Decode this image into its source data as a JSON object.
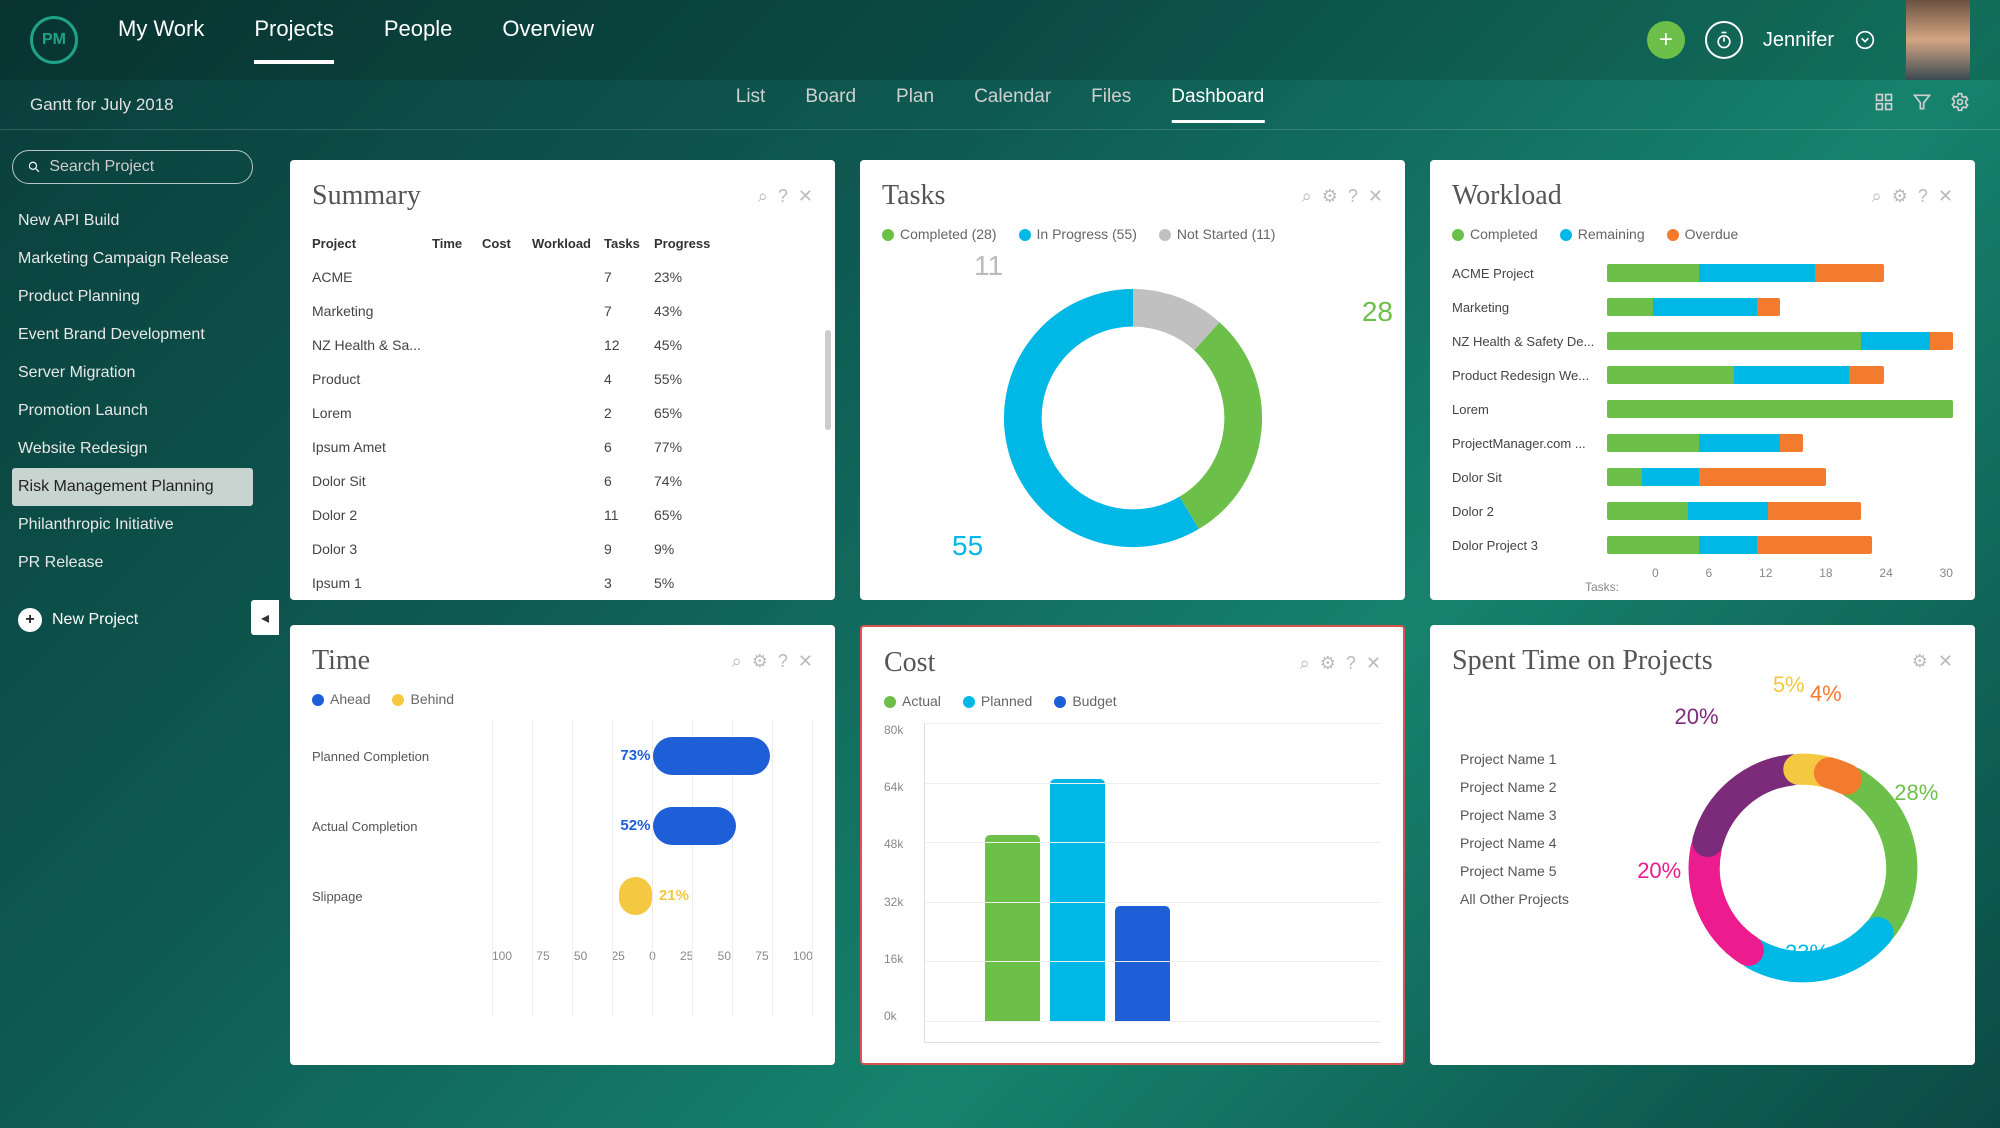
{
  "brand": "PM",
  "nav": {
    "items": [
      "My Work",
      "Projects",
      "People",
      "Overview"
    ],
    "active": 1
  },
  "topright": {
    "user": "Jennifer"
  },
  "crumb": "Gantt for July 2018",
  "subtabs": {
    "items": [
      "List",
      "Board",
      "Plan",
      "Calendar",
      "Files",
      "Dashboard"
    ],
    "active": 5
  },
  "search": {
    "placeholder": "Search Project"
  },
  "projects": [
    "New API Build",
    "Marketing Campaign Release",
    "Product Planning",
    "Event Brand Development",
    "Server Migration",
    "Promotion Launch",
    "Website Redesign",
    "Risk Management Planning",
    "Philanthropic Initiative",
    "PR Release"
  ],
  "projects_selected": 7,
  "new_project": "New Project",
  "summary": {
    "title": "Summary",
    "headers": [
      "Project",
      "Time",
      "Cost",
      "Workload",
      "Tasks",
      "Progress"
    ],
    "rows": [
      {
        "name": "ACME",
        "time": "r",
        "cost": "y",
        "work": "r",
        "tasks": 7,
        "progress": "23%"
      },
      {
        "name": "Marketing",
        "time": "g",
        "cost": "y",
        "work": "r",
        "tasks": 7,
        "progress": "43%"
      },
      {
        "name": "NZ Health & Sa...",
        "time": "g",
        "cost": "g",
        "work": "",
        "tasks": 12,
        "progress": "45%"
      },
      {
        "name": "Product",
        "time": "g",
        "cost": "",
        "work": "",
        "tasks": 4,
        "progress": "55%"
      },
      {
        "name": "Lorem",
        "time": "",
        "cost": "",
        "work": "",
        "tasks": 2,
        "progress": "65%"
      },
      {
        "name": "Ipsum Amet",
        "time": "",
        "cost": "",
        "work": "",
        "tasks": 6,
        "progress": "77%"
      },
      {
        "name": "Dolor Sit",
        "time": "",
        "cost": "",
        "work": "",
        "tasks": 6,
        "progress": "74%"
      },
      {
        "name": "Dolor 2",
        "time": "",
        "cost": "",
        "work": "",
        "tasks": 11,
        "progress": "65%"
      },
      {
        "name": "Dolor 3",
        "time": "",
        "cost": "",
        "work": "r",
        "tasks": 9,
        "progress": "9%"
      },
      {
        "name": "Ipsum 1",
        "time": "",
        "cost": "",
        "work": "r",
        "tasks": 3,
        "progress": "5%"
      }
    ]
  },
  "tasks": {
    "title": "Tasks",
    "legend": [
      {
        "label": "Completed",
        "count": 28,
        "color": "#6cc04a"
      },
      {
        "label": "In Progress",
        "count": 55,
        "color": "#00b8e6"
      },
      {
        "label": "Not Started",
        "count": 11,
        "color": "#c0c0c0"
      }
    ]
  },
  "workload": {
    "title": "Workload",
    "legend": [
      {
        "label": "Completed",
        "color": "#6cc04a"
      },
      {
        "label": "Remaining",
        "color": "#00b8e6"
      },
      {
        "label": "Overdue",
        "color": "#f37b2e"
      }
    ],
    "rows": [
      {
        "name": "ACME Project",
        "c": 8,
        "r": 10,
        "o": 6
      },
      {
        "name": "Marketing",
        "c": 4,
        "r": 9,
        "o": 2
      },
      {
        "name": "NZ Health & Safety De...",
        "c": 22,
        "r": 6,
        "o": 2
      },
      {
        "name": "Product Redesign We...",
        "c": 11,
        "r": 10,
        "o": 3
      },
      {
        "name": "Lorem",
        "c": 30,
        "r": 0,
        "o": 0
      },
      {
        "name": "ProjectManager.com ...",
        "c": 8,
        "r": 7,
        "o": 2
      },
      {
        "name": "Dolor Sit",
        "c": 3,
        "r": 5,
        "o": 11
      },
      {
        "name": "Dolor 2",
        "c": 7,
        "r": 7,
        "o": 8
      },
      {
        "name": "Dolor Project 3",
        "c": 8,
        "r": 5,
        "o": 10
      }
    ],
    "axis": [
      "0",
      "6",
      "12",
      "18",
      "24",
      "30"
    ],
    "axis_label": "Tasks:",
    "max": 30
  },
  "time": {
    "title": "Time",
    "legend": [
      {
        "label": "Ahead",
        "color": "#1e5fd8"
      },
      {
        "label": "Behind",
        "color": "#f5c842"
      }
    ],
    "rows": [
      {
        "label": "Planned Completion",
        "value": 73,
        "color": "#1e5fd8",
        "dir": 1
      },
      {
        "label": "Actual Completion",
        "value": 52,
        "color": "#1e5fd8",
        "dir": 1
      },
      {
        "label": "Slippage",
        "value": 21,
        "color": "#f5c842",
        "dir": -1
      }
    ],
    "axis": [
      "100",
      "75",
      "50",
      "25",
      "0",
      "25",
      "50",
      "75",
      "100"
    ]
  },
  "cost": {
    "title": "Cost",
    "legend": [
      {
        "label": "Actual",
        "color": "#6cc04a"
      },
      {
        "label": "Planned",
        "color": "#00b8e6"
      },
      {
        "label": "Budget",
        "color": "#1e5fd8"
      }
    ],
    "y": [
      "80k",
      "64k",
      "48k",
      "32k",
      "16k",
      "0k"
    ],
    "bars": [
      {
        "v": 50,
        "color": "#6cc04a"
      },
      {
        "v": 65,
        "color": "#00b8e6"
      },
      {
        "v": 31,
        "color": "#1e5fd8"
      }
    ],
    "max": 80
  },
  "spent": {
    "title": "Spent Time on Projects",
    "legend": [
      {
        "label": "Project Name 1",
        "color": "#6cc04a"
      },
      {
        "label": "Project Name 2",
        "color": "#00b8e6"
      },
      {
        "label": "Project Name 3",
        "color": "#ec1b8e"
      },
      {
        "label": "Project Name 4",
        "color": "#7c2b7a"
      },
      {
        "label": "Project Name 5",
        "color": "#f5c842"
      },
      {
        "label": "All Other Projects",
        "color": "#f37b2e"
      }
    ],
    "slices": [
      {
        "pct": 28,
        "color": "#6cc04a"
      },
      {
        "pct": 23,
        "color": "#00b8e6"
      },
      {
        "pct": 20,
        "color": "#ec1b8e"
      },
      {
        "pct": 20,
        "color": "#7c2b7a"
      },
      {
        "pct": 5,
        "color": "#f5c842"
      },
      {
        "pct": 4,
        "color": "#f37b2e"
      }
    ]
  },
  "chart_data": [
    {
      "type": "pie",
      "title": "Tasks",
      "series": [
        {
          "name": "Completed",
          "value": 28
        },
        {
          "name": "In Progress",
          "value": 55
        },
        {
          "name": "Not Started",
          "value": 11
        }
      ]
    },
    {
      "type": "bar",
      "title": "Workload",
      "xlabel": "Tasks",
      "axis": [
        0,
        6,
        12,
        18,
        24,
        30
      ],
      "categories": [
        "ACME Project",
        "Marketing",
        "NZ Health & Safety De...",
        "Product Redesign We...",
        "Lorem",
        "ProjectManager.com ...",
        "Dolor Sit",
        "Dolor 2",
        "Dolor Project 3"
      ],
      "series": [
        {
          "name": "Completed",
          "values": [
            8,
            4,
            22,
            11,
            30,
            8,
            3,
            7,
            8
          ]
        },
        {
          "name": "Remaining",
          "values": [
            10,
            9,
            6,
            10,
            0,
            7,
            5,
            7,
            5
          ]
        },
        {
          "name": "Overdue",
          "values": [
            6,
            2,
            2,
            3,
            0,
            2,
            11,
            8,
            10
          ]
        }
      ]
    },
    {
      "type": "bar",
      "title": "Time",
      "categories": [
        "Planned Completion",
        "Actual Completion",
        "Slippage"
      ],
      "values": [
        73,
        52,
        -21
      ],
      "xlim": [
        -100,
        100
      ]
    },
    {
      "type": "bar",
      "title": "Cost",
      "categories": [
        "Actual",
        "Planned",
        "Budget"
      ],
      "values": [
        50,
        65,
        31
      ],
      "ylabel": "k",
      "ylim": [
        0,
        80
      ]
    },
    {
      "type": "pie",
      "title": "Spent Time on Projects",
      "series": [
        {
          "name": "Project Name 1",
          "value": 28
        },
        {
          "name": "Project Name 2",
          "value": 23
        },
        {
          "name": "Project Name 3",
          "value": 20
        },
        {
          "name": "Project Name 4",
          "value": 20
        },
        {
          "name": "Project Name 5",
          "value": 5
        },
        {
          "name": "All Other Projects",
          "value": 4
        }
      ]
    }
  ]
}
